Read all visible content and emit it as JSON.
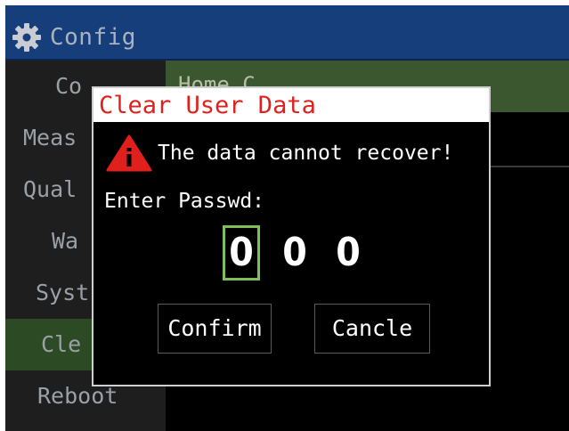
{
  "header": {
    "title": "Config",
    "icon": "gear-icon"
  },
  "sidebar": {
    "items": [
      {
        "label": "Co"
      },
      {
        "label": "Meas"
      },
      {
        "label": "Qual"
      },
      {
        "label": "Wa"
      },
      {
        "label": "Syst"
      },
      {
        "label": "Cle"
      },
      {
        "label": "Reboot"
      }
    ],
    "active_index": 5
  },
  "content": {
    "top_text": "Home C"
  },
  "dialog": {
    "title": "Clear User Data",
    "warning_icon": "warning-icon",
    "warning_text": "The data cannot recover!",
    "password_label": "Enter Passwd:",
    "digits": [
      "0",
      "0",
      "0"
    ],
    "focused_digit_index": 0,
    "confirm_label": "Confirm",
    "cancel_label": "Cancle"
  },
  "colors": {
    "titlebar": "#163e7a",
    "dialog_title": "#e0201c",
    "focus_border": "#7fbf5a",
    "active_sidebar": "#2c4a24",
    "content_highlight": "#3a5730"
  }
}
